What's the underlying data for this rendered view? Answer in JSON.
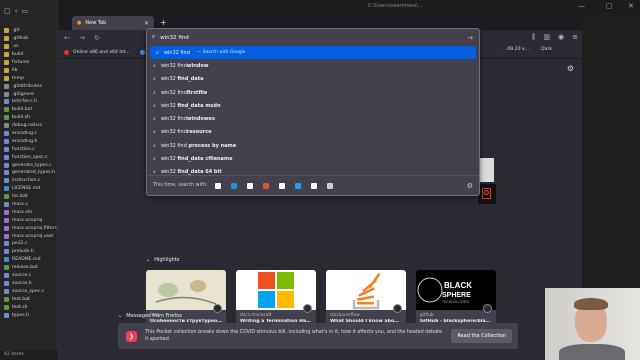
{
  "explorer": {
    "items": [
      {
        "name": ".git",
        "color": "#c9a54a"
      },
      {
        "name": ".github",
        "color": "#c9a54a"
      },
      {
        "name": ".vs",
        "color": "#c9a54a"
      },
      {
        "name": "build",
        "color": "#c9a54a"
      },
      {
        "name": "fixtures",
        "color": "#c9a54a"
      },
      {
        "name": "lib",
        "color": "#c9a54a"
      },
      {
        "name": "temp",
        "color": "#c9a54a"
      },
      {
        "name": ".gitattributes",
        "color": "#888888"
      },
      {
        "name": ".gitignore",
        "color": "#888888"
      },
      {
        "name": "bdd-for-c.h",
        "color": "#6b8cce"
      },
      {
        "name": "build.bat",
        "color": "#5a9a4a"
      },
      {
        "name": "build.sh",
        "color": "#5a9a4a"
      },
      {
        "name": "debug.natvis",
        "color": "#888888"
      },
      {
        "name": "encoding.c",
        "color": "#6b8cce"
      },
      {
        "name": "encoding.h",
        "color": "#6b8cce"
      },
      {
        "name": "function.c",
        "color": "#6b8cce"
      },
      {
        "name": "function_spec.c",
        "color": "#6b8cce"
      },
      {
        "name": "generate_types.c",
        "color": "#6b8cce"
      },
      {
        "name": "generated_types.h",
        "color": "#6b8cce"
      },
      {
        "name": "instruction.c",
        "color": "#6b8cce"
      },
      {
        "name": "LICENSE.md",
        "color": "#4a8ad4"
      },
      {
        "name": "loc.bat",
        "color": "#5a9a4a"
      },
      {
        "name": "mass.c",
        "color": "#6b8cce"
      },
      {
        "name": "mass.sln",
        "color": "#9a6ad4"
      },
      {
        "name": "mass.vcxproj",
        "color": "#9a6ad4"
      },
      {
        "name": "mass.vcxproj.filters",
        "color": "#9a6ad4"
      },
      {
        "name": "mass.vcxproj.user",
        "color": "#9a6ad4"
      },
      {
        "name": "pe32.c",
        "color": "#6b8cce"
      },
      {
        "name": "prelude.h",
        "color": "#6b8cce"
      },
      {
        "name": "README.md",
        "color": "#4a8ad4"
      },
      {
        "name": "release.bat",
        "color": "#5a9a4a"
      },
      {
        "name": "source.c",
        "color": "#6b8cce"
      },
      {
        "name": "source.h",
        "color": "#6b8cce"
      },
      {
        "name": "source_spec.c",
        "color": "#6b8cce"
      },
      {
        "name": "test.bat",
        "color": "#5a9a4a"
      },
      {
        "name": "test.sh",
        "color": "#5a9a4a"
      },
      {
        "name": "types.h",
        "color": "#6b8cce"
      }
    ],
    "status": "42 items"
  },
  "editor": {
    "title": "C:\\Users\\user\\mass\\..."
  },
  "browser": {
    "tab_title": "New Tab",
    "bookmarks": [
      "Online x86 and x64 Int...",
      "Compi..."
    ],
    "bookmarks_right": [
      "...09.20 x...",
      "Dark"
    ],
    "url_value": "win32 find",
    "suggestions": [
      {
        "prefix": "win32 find",
        "bold": "",
        "hint": "— Search with Google"
      },
      {
        "prefix": "win32 find",
        "bold": "window",
        "hint": ""
      },
      {
        "prefix": "win32 ",
        "bold": "find_data",
        "hint": ""
      },
      {
        "prefix": "win32 find",
        "bold": "firstfile",
        "hint": ""
      },
      {
        "prefix": "win32 ",
        "bold": "find_data msdn",
        "hint": ""
      },
      {
        "prefix": "win32 find",
        "bold": "windowex",
        "hint": ""
      },
      {
        "prefix": "win32 find",
        "bold": "resource",
        "hint": ""
      },
      {
        "prefix": "win32 find ",
        "bold": "process by name",
        "hint": ""
      },
      {
        "prefix": "win32 ",
        "bold": "find_data cfilename",
        "hint": ""
      },
      {
        "prefix": "win32 ",
        "bold": "find_data 64 bit",
        "hint": ""
      }
    ],
    "search_with_label": "This time, search with:",
    "engines": [
      {
        "name": "google",
        "color": "#ffffff"
      },
      {
        "name": "bing",
        "color": "#2a8fd9"
      },
      {
        "name": "amazon",
        "color": "#ffffff"
      },
      {
        "name": "duckduckgo",
        "color": "#de5833"
      },
      {
        "name": "ebay",
        "color": "#ffffff"
      },
      {
        "name": "twitter",
        "color": "#1da1f2"
      },
      {
        "name": "wikipedia",
        "color": "#ffffff"
      },
      {
        "name": "history",
        "color": "#cccccc"
      }
    ],
    "highlights_label": "Highlights",
    "cards": [
      {
        "source": "habr",
        "title": "Особенности структурно...",
        "bg": "#e9e4d2"
      },
      {
        "source": "docs.microsoft",
        "title": "Writing a Termination Han...",
        "bg": "#ffffff"
      },
      {
        "source": "stackoverflow",
        "title": "What Should I know about ...",
        "bg": "#ffffff"
      },
      {
        "source": "github",
        "title": "GitHub - blacksphere/blac...",
        "bg": "#000000"
      }
    ],
    "messages_label": "Messages from Firefox",
    "message_text": "This Pocket collection breaks down the COVID stimulus bill, including what's in it, how it affects you, and the heated debate it sparked.",
    "read_button": "Read the Collection",
    "blacksphere_logo": "BLACK SPHERE TECHNOLOGIES"
  }
}
